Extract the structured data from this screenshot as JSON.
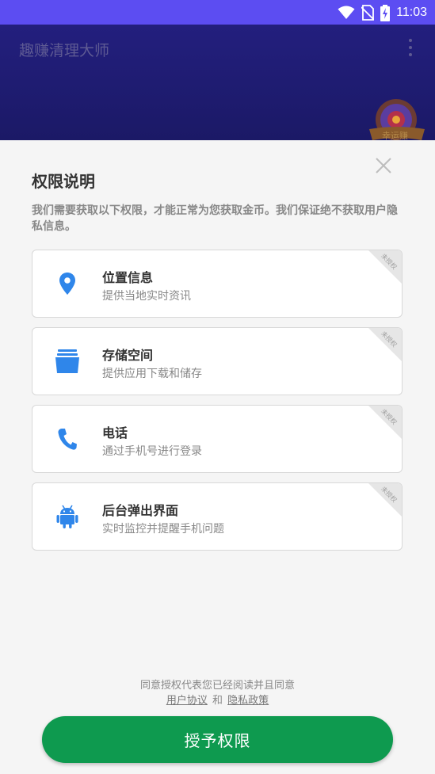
{
  "status_bar": {
    "time": "11:03",
    "icons": [
      "wifi-icon",
      "no-sim-icon",
      "battery-charging-icon"
    ],
    "background": "#5c4df2"
  },
  "app_bar": {
    "title": "趣赚清理大师",
    "menu_icon": "overflow-menu-icon",
    "badge_text": "幸运赚",
    "background": "#1b1966"
  },
  "dialog": {
    "title": "权限说明",
    "description": "我们需要获取以下权限，才能正常为您获取金币。我们保证绝不获取用户隐私信息。",
    "close_icon": "close-icon",
    "permissions": [
      {
        "icon": "location-pin-icon",
        "name": "位置信息",
        "desc": "提供当地实时资讯",
        "tag": "未授权"
      },
      {
        "icon": "storage-icon",
        "name": "存储空间",
        "desc": "提供应用下载和储存",
        "tag": "未授权"
      },
      {
        "icon": "phone-icon",
        "name": "电话",
        "desc": "通过手机号进行登录",
        "tag": "未授权"
      },
      {
        "icon": "android-icon",
        "name": "后台弹出界面",
        "desc": "实时监控并提醒手机问题",
        "tag": "未授权"
      }
    ],
    "agreement_text": "同意授权代表您已经阅读并且同意",
    "user_agreement": "用户协议",
    "and": "和",
    "privacy_policy": "隐私政策",
    "grant_button": "授予权限"
  },
  "colors": {
    "accent_blue": "#2f86ea",
    "button_green": "#0e9a4f"
  }
}
